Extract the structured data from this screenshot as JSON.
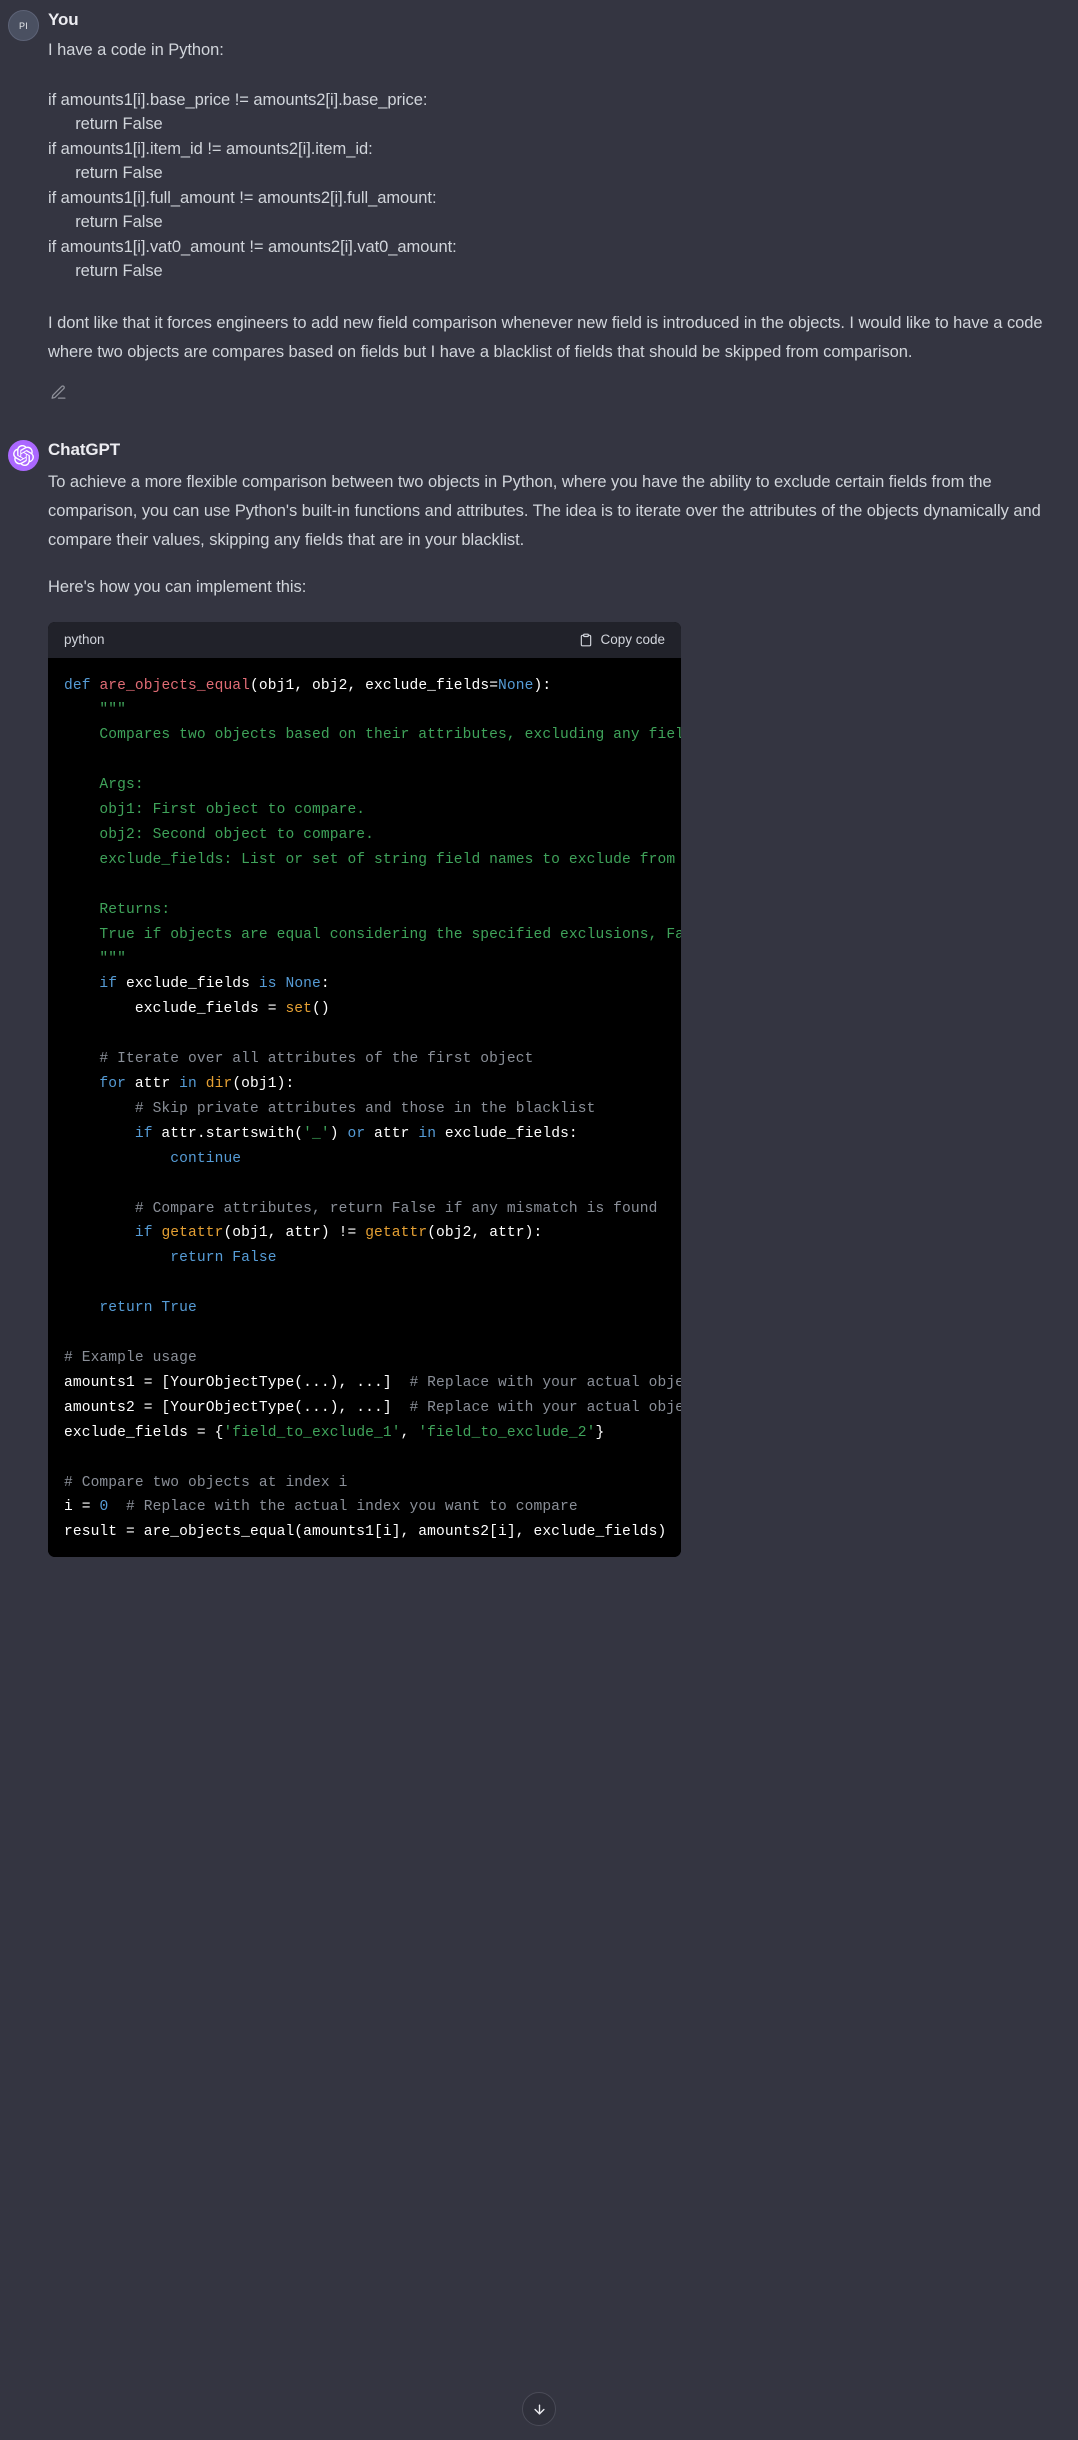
{
  "user": {
    "avatar_initials": "PI",
    "author": "You",
    "intro": "I have a code in Python:",
    "pasted_code": "if amounts1[i].base_price != amounts2[i].base_price:\n      return False\nif amounts1[i].item_id != amounts2[i].item_id:\n      return False\nif amounts1[i].full_amount != amounts2[i].full_amount:\n      return False\nif amounts1[i].vat0_amount != amounts2[i].vat0_amount:\n      return False",
    "question": "I dont like that it forces engineers to add new field comparison whenever new field is introduced in the objects. I would like to have a code where two objects are compares based on fields but I have a blacklist of fields that should be skipped from comparison.",
    "edit_icon": "pencil-icon"
  },
  "assistant": {
    "avatar_icon": "openai-logo-icon",
    "avatar_color": "#ab68ff",
    "author": "ChatGPT",
    "paragraph_1": "To achieve a more flexible comparison between two objects in Python, where you have the ability to exclude certain fields from the comparison, you can use Python's built-in functions and attributes. The idea is to iterate over the attributes of the objects dynamically and compare their values, skipping any fields that are in your blacklist.",
    "paragraph_2": "Here's how you can implement this:"
  },
  "codeblock": {
    "language": "python",
    "copy_label": "Copy code",
    "copy_icon": "clipboard-icon",
    "lines": [
      {
        "segs": [
          {
            "t": "def ",
            "c": "kw"
          },
          {
            "t": "are_objects_equal",
            "c": "fn"
          },
          {
            "t": "(obj1, obj2, exclude_fields=",
            "c": "plain"
          },
          {
            "t": "None",
            "c": "kw"
          },
          {
            "t": "):",
            "c": "plain"
          }
        ]
      },
      {
        "segs": [
          {
            "t": "    \"\"\"",
            "c": "doc"
          }
        ]
      },
      {
        "segs": [
          {
            "t": "    Compares two objects based on their attributes, excluding any field",
            "c": "doc"
          }
        ]
      },
      {
        "segs": [
          {
            "t": "",
            "c": "plain"
          }
        ]
      },
      {
        "segs": [
          {
            "t": "    Args:",
            "c": "doc"
          }
        ]
      },
      {
        "segs": [
          {
            "t": "    obj1: First object to compare.",
            "c": "doc"
          }
        ]
      },
      {
        "segs": [
          {
            "t": "    obj2: Second object to compare.",
            "c": "doc"
          }
        ]
      },
      {
        "segs": [
          {
            "t": "    exclude_fields: List or set of string field names to exclude from c",
            "c": "doc"
          }
        ]
      },
      {
        "segs": [
          {
            "t": "",
            "c": "plain"
          }
        ]
      },
      {
        "segs": [
          {
            "t": "    Returns:",
            "c": "doc"
          }
        ]
      },
      {
        "segs": [
          {
            "t": "    True if objects are equal considering the specified exclusions, Fal",
            "c": "doc"
          }
        ]
      },
      {
        "segs": [
          {
            "t": "    \"\"\"",
            "c": "doc"
          }
        ]
      },
      {
        "segs": [
          {
            "t": "    if",
            "c": "kw"
          },
          {
            "t": " exclude_fields ",
            "c": "plain"
          },
          {
            "t": "is",
            "c": "kw"
          },
          {
            "t": " ",
            "c": "plain"
          },
          {
            "t": "None",
            "c": "kw"
          },
          {
            "t": ":",
            "c": "plain"
          }
        ]
      },
      {
        "segs": [
          {
            "t": "        exclude_fields = ",
            "c": "plain"
          },
          {
            "t": "set",
            "c": "bi"
          },
          {
            "t": "()",
            "c": "plain"
          }
        ]
      },
      {
        "segs": [
          {
            "t": "",
            "c": "plain"
          }
        ]
      },
      {
        "segs": [
          {
            "t": "    # Iterate over all attributes of the first object",
            "c": "com"
          }
        ]
      },
      {
        "segs": [
          {
            "t": "    for",
            "c": "kw"
          },
          {
            "t": " attr ",
            "c": "plain"
          },
          {
            "t": "in",
            "c": "kw"
          },
          {
            "t": " ",
            "c": "plain"
          },
          {
            "t": "dir",
            "c": "bi"
          },
          {
            "t": "(obj1):",
            "c": "plain"
          }
        ]
      },
      {
        "segs": [
          {
            "t": "        # Skip private attributes and those in the blacklist",
            "c": "com"
          }
        ]
      },
      {
        "segs": [
          {
            "t": "        if",
            "c": "kw"
          },
          {
            "t": " attr.startswith(",
            "c": "plain"
          },
          {
            "t": "'_'",
            "c": "str"
          },
          {
            "t": ") ",
            "c": "plain"
          },
          {
            "t": "or",
            "c": "kw"
          },
          {
            "t": " attr ",
            "c": "plain"
          },
          {
            "t": "in",
            "c": "kw"
          },
          {
            "t": " exclude_fields:",
            "c": "plain"
          }
        ]
      },
      {
        "segs": [
          {
            "t": "            continue",
            "c": "kw"
          }
        ]
      },
      {
        "segs": [
          {
            "t": "",
            "c": "plain"
          }
        ]
      },
      {
        "segs": [
          {
            "t": "        # Compare attributes, return False if any mismatch is found",
            "c": "com"
          }
        ]
      },
      {
        "segs": [
          {
            "t": "        if ",
            "c": "kw"
          },
          {
            "t": "getattr",
            "c": "bi"
          },
          {
            "t": "(obj1, attr) != ",
            "c": "plain"
          },
          {
            "t": "getattr",
            "c": "bi"
          },
          {
            "t": "(obj2, attr):",
            "c": "plain"
          }
        ]
      },
      {
        "segs": [
          {
            "t": "            return False",
            "c": "kw"
          }
        ]
      },
      {
        "segs": [
          {
            "t": "",
            "c": "plain"
          }
        ]
      },
      {
        "segs": [
          {
            "t": "    return True",
            "c": "kw"
          }
        ]
      },
      {
        "segs": [
          {
            "t": "",
            "c": "plain"
          }
        ]
      },
      {
        "segs": [
          {
            "t": "# Example usage",
            "c": "com"
          }
        ]
      },
      {
        "segs": [
          {
            "t": "amounts1 = [YourObjectType(...), ...]  ",
            "c": "plain"
          },
          {
            "t": "# Replace with your actual objec",
            "c": "com"
          }
        ]
      },
      {
        "segs": [
          {
            "t": "amounts2 = [YourObjectType(...), ...]  ",
            "c": "plain"
          },
          {
            "t": "# Replace with your actual objec",
            "c": "com"
          }
        ]
      },
      {
        "segs": [
          {
            "t": "exclude_fields = {",
            "c": "plain"
          },
          {
            "t": "'field_to_exclude_1'",
            "c": "str"
          },
          {
            "t": ", ",
            "c": "plain"
          },
          {
            "t": "'field_to_exclude_2'",
            "c": "str"
          },
          {
            "t": "}",
            "c": "plain"
          }
        ]
      },
      {
        "segs": [
          {
            "t": "",
            "c": "plain"
          }
        ]
      },
      {
        "segs": [
          {
            "t": "# Compare two objects at index i",
            "c": "com"
          }
        ]
      },
      {
        "segs": [
          {
            "t": "i = ",
            "c": "plain"
          },
          {
            "t": "0",
            "c": "kw"
          },
          {
            "t": "  ",
            "c": "plain"
          },
          {
            "t": "# Replace with the actual index you want to compare",
            "c": "com"
          }
        ]
      },
      {
        "segs": [
          {
            "t": "result = are_objects_equal(amounts1[i], amounts2[i], exclude_fields)",
            "c": "plain"
          }
        ]
      }
    ]
  },
  "scroll_button": {
    "icon": "arrow-down-icon"
  }
}
